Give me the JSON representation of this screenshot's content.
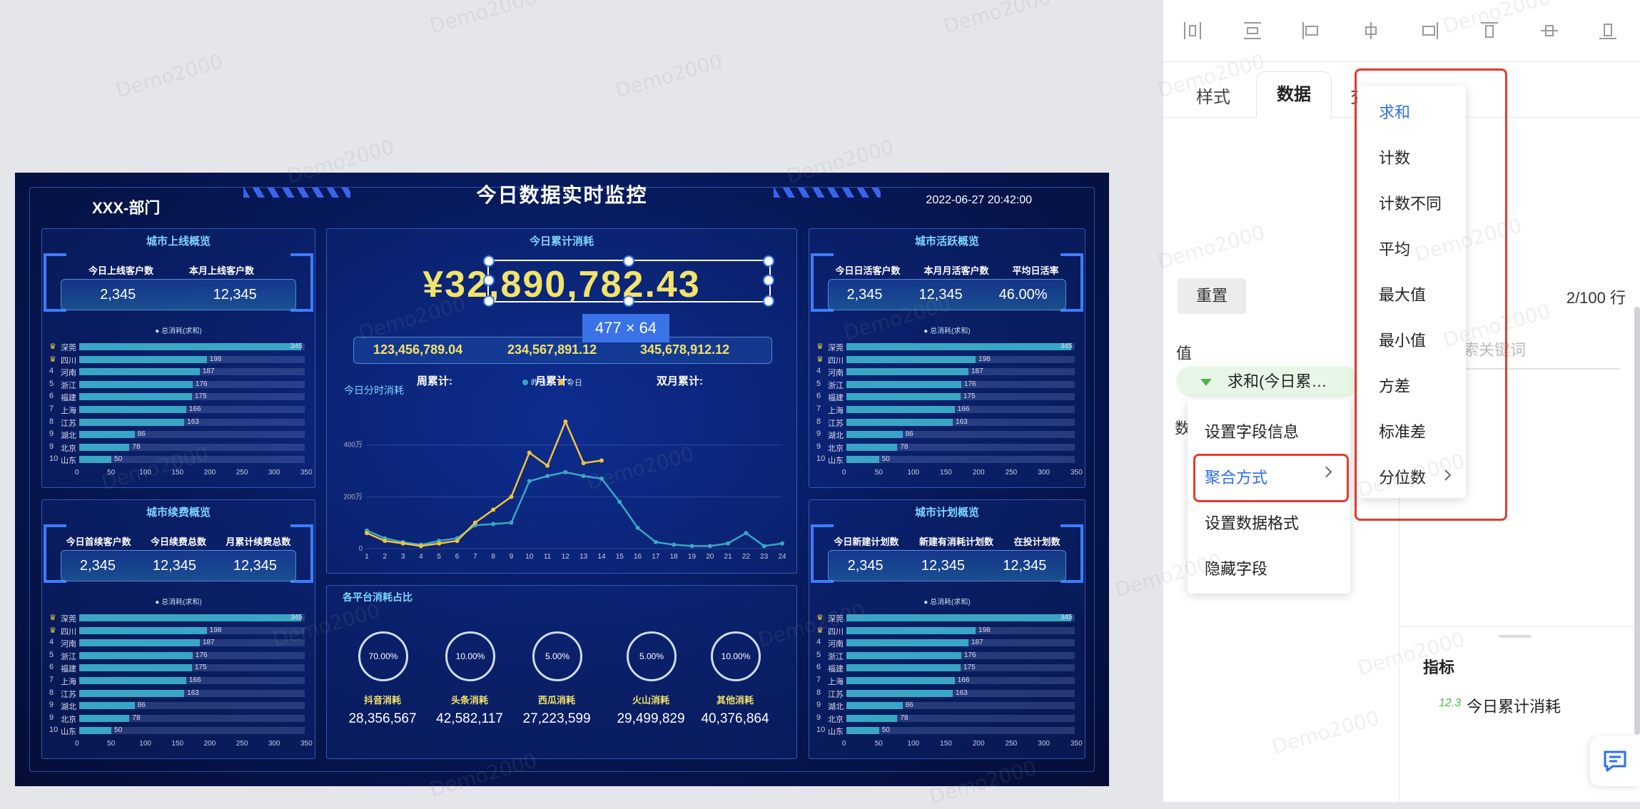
{
  "dashboard": {
    "title": "今日数据实时监控",
    "dept": "XXX-部门",
    "datetime": "2022-06-27 20:42:00",
    "left_top": {
      "title": "城市上线概览",
      "stats": [
        {
          "label": "今日上线客户数",
          "value": "2,345"
        },
        {
          "label": "本月上线客户数",
          "value": "12,345"
        }
      ]
    },
    "left_bottom": {
      "title": "城市续费概览",
      "stats": [
        {
          "label": "今日首续客户数",
          "value": "2,345"
        },
        {
          "label": "今日续费总数",
          "value": "12,345"
        },
        {
          "label": "月累计续费总数",
          "value": "12,345"
        }
      ]
    },
    "right_top": {
      "title": "城市活跃概览",
      "stats": [
        {
          "label": "今日日活客户数",
          "value": "2,345"
        },
        {
          "label": "本月月活客户数",
          "value": "12,345"
        },
        {
          "label": "平均日活率",
          "value": "46.00%"
        }
      ]
    },
    "right_bottom": {
      "title": "城市计划概览",
      "stats": [
        {
          "label": "今日新建计划数",
          "value": "2,345"
        },
        {
          "label": "新建有消耗计划数",
          "value": "12,345"
        },
        {
          "label": "在投计划数",
          "value": "12,345"
        }
      ]
    },
    "bar_legend": "总消耗(求和)",
    "city_bars": {
      "type": "bar",
      "categories": [
        "深莞",
        "四川",
        "河南",
        "浙江",
        "福建",
        "上海",
        "江苏",
        "湖北",
        "北京",
        "山东"
      ],
      "ranks": [
        "♛",
        "♛",
        "4",
        "5",
        "6",
        "7",
        "8",
        "9",
        "9",
        "10"
      ],
      "values": [
        345,
        198,
        187,
        176,
        175,
        166,
        163,
        86,
        78,
        50
      ],
      "xticks": [
        "0",
        "50",
        "100",
        "150",
        "200",
        "250",
        "300",
        "350"
      ],
      "xlim": [
        0,
        350
      ]
    },
    "center": {
      "title": "今日累计消耗",
      "big_number": "¥32,890,782.43",
      "selection_size": "477 × 64",
      "cum_labels": [
        "周累计:",
        "月累计:",
        "双月累计:"
      ],
      "cum_values": [
        "123,456,789.04",
        "234,567,891.12",
        "345,678,912.12"
      ],
      "chart_title": "今日分时消耗",
      "legend": [
        "昨日",
        "今日"
      ],
      "yticks": [
        "0",
        "200万",
        "400万"
      ],
      "platform_title": "各平台消耗占比",
      "platforms": [
        {
          "pct": "70.00%",
          "name": "抖音消耗",
          "value": "28,356,567"
        },
        {
          "pct": "10.00%",
          "name": "头条消耗",
          "value": "42,582,117"
        },
        {
          "pct": "5.00%",
          "name": "西瓜消耗",
          "value": "27,223,599"
        },
        {
          "pct": "5.00%",
          "name": "火山消耗",
          "value": "29,499,829"
        },
        {
          "pct": "10.00%",
          "name": "其他消耗",
          "value": "40,376,864"
        }
      ]
    }
  },
  "chart_data": {
    "type": "line",
    "title": "今日分时消耗",
    "x": [
      1,
      2,
      3,
      4,
      5,
      6,
      7,
      8,
      9,
      10,
      11,
      12,
      13,
      14,
      15,
      16,
      17,
      18,
      19,
      20,
      21,
      22,
      23,
      24
    ],
    "ylim": [
      0,
      600
    ],
    "series": [
      {
        "name": "昨日",
        "values": [
          70,
          40,
          25,
          15,
          30,
          40,
          90,
          95,
          100,
          260,
          280,
          295,
          280,
          270,
          180,
          80,
          25,
          15,
          10,
          10,
          20,
          60,
          10,
          20
        ]
      },
      {
        "name": "今日",
        "values": [
          60,
          30,
          20,
          10,
          20,
          30,
          100,
          150,
          200,
          370,
          320,
          490,
          330,
          340
        ]
      }
    ]
  },
  "editor": {
    "tabs": [
      "样式",
      "数据",
      "交"
    ],
    "reset_label": "重置",
    "row_count": "2/100 行",
    "value_header": "值",
    "value_pill": "求和(今日累…",
    "shu_label": "数",
    "search_placeholder": "索关键词",
    "metrics_header": "指标",
    "metric_icon": "12.3",
    "metric_item": "今日累计消耗",
    "context_menu": [
      "设置字段信息",
      "聚合方式",
      "设置数据格式",
      "隐藏字段"
    ],
    "aggregation": [
      "求和",
      "计数",
      "计数不同",
      "平均",
      "最大值",
      "最小值",
      "方差",
      "标准差",
      "分位数"
    ],
    "accent": "#2f6ef0",
    "highlight": "#e33b2e"
  },
  "watermark": "Demo2000"
}
